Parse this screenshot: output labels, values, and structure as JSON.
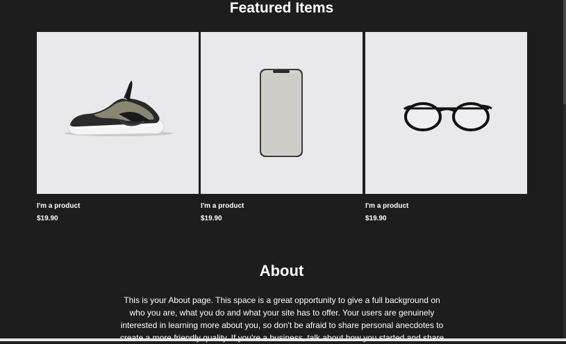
{
  "featured": {
    "title": "Featured Items",
    "products": [
      {
        "name": "I'm a product",
        "price": "$19.90",
        "icon": "sneaker-image"
      },
      {
        "name": "I'm a product",
        "price": "$19.90",
        "icon": "smartphone-image"
      },
      {
        "name": "I'm a product",
        "price": "$19.90",
        "icon": "eyeglasses-image"
      }
    ]
  },
  "about": {
    "title": "About",
    "body": "This is your About page. This space is a great opportunity to give a full background on who you are, what you do and what your site has to offer. Your users are genuinely interested in learning more about you, so don't be afraid to share personal anecdotes to create a more friendly quality. If you're a business, talk about how you started and share"
  },
  "colors": {
    "background": "#1d1d1d",
    "card": "#e9e9ec",
    "text": "#ffffff"
  }
}
